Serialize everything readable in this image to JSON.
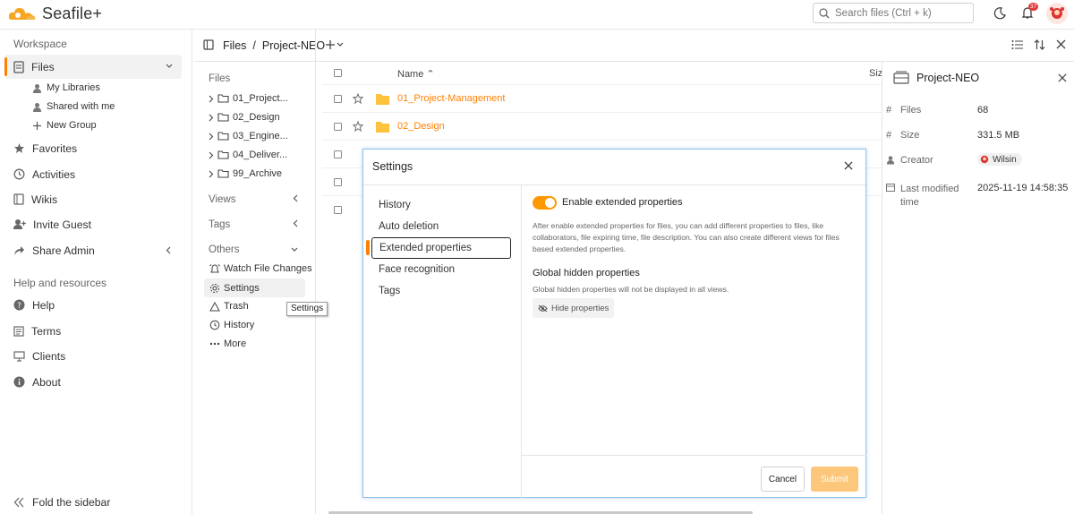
{
  "app": {
    "name": "Seafile+",
    "notif_count": "37"
  },
  "search": {
    "placeholder": "Search files (Ctrl + k)"
  },
  "sidebar": {
    "workspace_label": "Workspace",
    "files": "Files",
    "my_libraries": "My Libraries",
    "shared_with_me": "Shared with me",
    "new_group": "New Group",
    "favorites": "Favorites",
    "activities": "Activities",
    "wikis": "Wikis",
    "invite_guest": "Invite Guest",
    "share_admin": "Share Admin",
    "help_label": "Help and resources",
    "help": "Help",
    "terms": "Terms",
    "clients": "Clients",
    "about": "About",
    "fold": "Fold the sidebar"
  },
  "breadcrumb": {
    "root": "Files",
    "sep": "/",
    "current": "Project-NEO"
  },
  "dirside": {
    "files_label": "Files",
    "folders": [
      "01_Project...",
      "02_Design",
      "03_Engine...",
      "04_Deliver...",
      "99_Archive"
    ],
    "views_label": "Views",
    "tags_label": "Tags",
    "others_label": "Others",
    "watch": "Watch File Changes",
    "settings": "Settings",
    "trash": "Trash",
    "history": "History",
    "more": "More",
    "tooltip": "Settings"
  },
  "filelist": {
    "name_header": "Name",
    "size_header": "Siz",
    "rows": [
      "01_Project-Management",
      "02_Design"
    ]
  },
  "detail": {
    "title": "Project-NEO",
    "files_label": "Files",
    "files_value": "68",
    "size_label": "Size",
    "size_value": "331.5 MB",
    "creator_label": "Creator",
    "creator_value": "Wilsin",
    "modified_label": "Last modified time",
    "modified_value": "2025-11-19 14:58:35"
  },
  "dialog": {
    "title": "Settings",
    "nav": [
      "History",
      "Auto deletion",
      "Extended properties",
      "Face recognition",
      "Tags"
    ],
    "enable_label": "Enable extended properties",
    "enable_desc": "After enable extended properties for files, you can add different properties to files, like collaborators, file expiring time, file description. You can also create different views for files based extended properties.",
    "hidden_title": "Global hidden properties",
    "hidden_desc": "Global hidden properties will not be displayed in all views.",
    "hide_button": "Hide properties",
    "cancel": "Cancel",
    "submit": "Submit"
  },
  "colors": {
    "accent": "#ff8000",
    "folder": "#ffc23d",
    "submit": "#fcc77a"
  }
}
